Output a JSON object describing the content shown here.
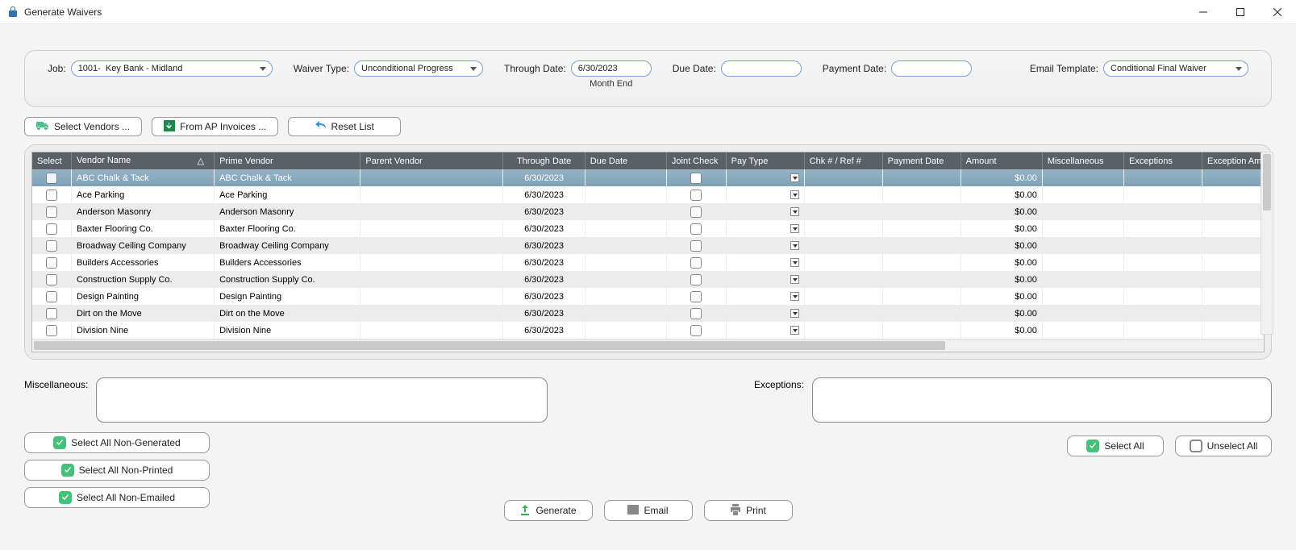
{
  "window": {
    "title": "Generate Waivers"
  },
  "filters": {
    "job": {
      "label": "Job:",
      "value": "1001-  Key Bank - Midland"
    },
    "waiverType": {
      "label": "Waiver Type:",
      "value": "Unconditional Progress"
    },
    "throughDate": {
      "label": "Through Date:",
      "value": "6/30/2023",
      "sub": "Month End"
    },
    "dueDate": {
      "label": "Due Date:",
      "value": ""
    },
    "paymentDate": {
      "label": "Payment Date:",
      "value": ""
    },
    "emailTemplate": {
      "label": "Email Template:",
      "value": "Conditional Final Waiver"
    }
  },
  "toolbar": {
    "selectVendors": "Select Vendors ...",
    "fromAP": "From AP Invoices ...",
    "resetList": "Reset List"
  },
  "grid": {
    "columns": {
      "select": "Select",
      "vendorName": "Vendor Name",
      "primeVendor": "Prime Vendor",
      "parentVendor": "Parent Vendor",
      "throughDate": "Through Date",
      "dueDate": "Due Date",
      "jointCheck": "Joint Check",
      "payType": "Pay Type",
      "chkRef": "Chk # / Ref #",
      "paymentDate": "Payment Date",
      "amount": "Amount",
      "miscellaneous": "Miscellaneous",
      "exceptions": "Exceptions",
      "exceptionAm": "Exception Am"
    },
    "rows": [
      {
        "vendorName": "ABC Chalk & Tack",
        "primeVendor": "ABC Chalk & Tack",
        "throughDate": "6/30/2023",
        "amount": "$0.00",
        "selected": true
      },
      {
        "vendorName": "Ace Parking",
        "primeVendor": "Ace Parking",
        "throughDate": "6/30/2023",
        "amount": "$0.00"
      },
      {
        "vendorName": "Anderson Masonry",
        "primeVendor": "Anderson Masonry",
        "throughDate": "6/30/2023",
        "amount": "$0.00"
      },
      {
        "vendorName": "Baxter Flooring Co.",
        "primeVendor": "Baxter Flooring Co.",
        "throughDate": "6/30/2023",
        "amount": "$0.00"
      },
      {
        "vendorName": "Broadway Ceiling Company",
        "primeVendor": "Broadway Ceiling Company",
        "throughDate": "6/30/2023",
        "amount": "$0.00"
      },
      {
        "vendorName": "Builders Accessories",
        "primeVendor": "Builders Accessories",
        "throughDate": "6/30/2023",
        "amount": "$0.00"
      },
      {
        "vendorName": "Construction Supply Co.",
        "primeVendor": "Construction Supply Co.",
        "throughDate": "6/30/2023",
        "amount": "$0.00"
      },
      {
        "vendorName": "Design Painting",
        "primeVendor": "Design Painting",
        "throughDate": "6/30/2023",
        "amount": "$0.00"
      },
      {
        "vendorName": "Dirt on the Move",
        "primeVendor": "Dirt on the Move",
        "throughDate": "6/30/2023",
        "amount": "$0.00"
      },
      {
        "vendorName": "Division Nine",
        "primeVendor": "Division Nine",
        "throughDate": "6/30/2023",
        "amount": "$0.00"
      }
    ]
  },
  "bottom": {
    "miscLabel": "Miscellaneous:",
    "miscValue": "",
    "excLabel": "Exceptions:",
    "excValue": ""
  },
  "footer": {
    "selNonGenerated": "Select All Non-Generated",
    "selNonPrinted": "Select All Non-Printed",
    "selNonEmailed": "Select All Non-Emailed",
    "generate": "Generate",
    "email": "Email",
    "print": "Print",
    "selectAll": "Select All",
    "unselectAll": "Unselect All"
  }
}
